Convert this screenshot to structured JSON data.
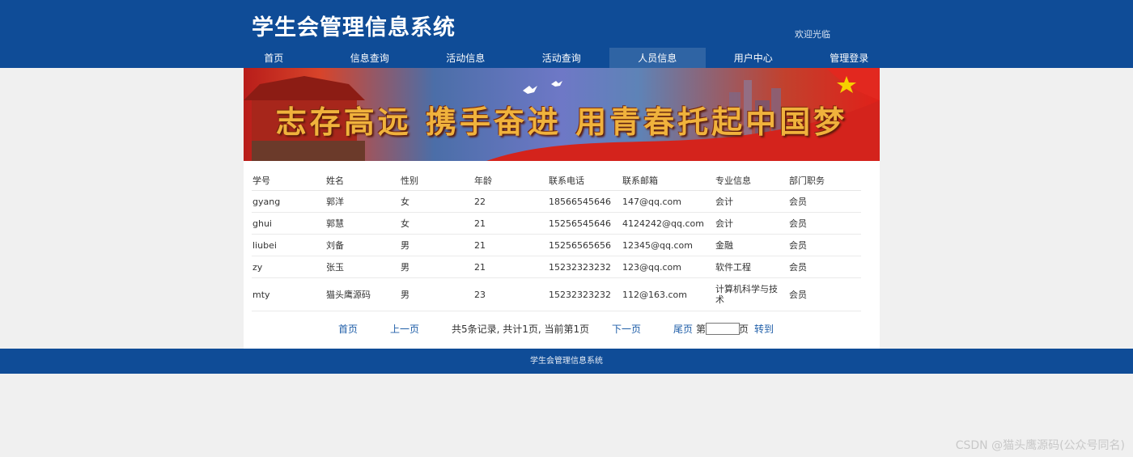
{
  "header": {
    "site_title": "学生会管理信息系统",
    "welcome": "欢迎光临"
  },
  "nav": {
    "items": [
      {
        "label": "首页",
        "active": false
      },
      {
        "label": "信息查询",
        "active": false
      },
      {
        "label": "活动信息",
        "active": false
      },
      {
        "label": "活动查询",
        "active": false
      },
      {
        "label": "人员信息",
        "active": true
      },
      {
        "label": "用户中心",
        "active": false
      },
      {
        "label": "管理登录",
        "active": false
      }
    ]
  },
  "banner": {
    "slogan": "志存高远 携手奋进 用青春托起中国梦"
  },
  "table": {
    "columns": [
      "学号",
      "姓名",
      "性别",
      "年龄",
      "联系电话",
      "联系邮箱",
      "专业信息",
      "部门职务"
    ],
    "rows": [
      [
        "gyang",
        "郭洋",
        "女",
        "22",
        "18566545646",
        "147@qq.com",
        "会计",
        "会员"
      ],
      [
        "ghui",
        "郭慧",
        "女",
        "21",
        "15256545646",
        "4124242@qq.com",
        "会计",
        "会员"
      ],
      [
        "liubei",
        "刘备",
        "男",
        "21",
        "15256565656",
        "12345@qq.com",
        "金融",
        "会员"
      ],
      [
        "zy",
        "张玉",
        "男",
        "21",
        "15232323232",
        "123@qq.com",
        "软件工程",
        "会员"
      ],
      [
        "mty",
        "猫头鹰源码",
        "男",
        "23",
        "15232323232",
        "112@163.com",
        "计算机科学与技术",
        "会员"
      ]
    ]
  },
  "pager": {
    "first": "首页",
    "prev": "上一页",
    "summary": "共5条记录, 共计1页, 当前第1页",
    "next": "下一页",
    "last": "尾页",
    "page_prefix": "第",
    "page_suffix": "页",
    "page_input": "",
    "go": "转到"
  },
  "footer": {
    "text": "学生会管理信息系统"
  },
  "watermark": "CSDN @猫头鹰源码(公众号同名)",
  "colors": {
    "header_bg": "#0f4c97",
    "nav_active": "#2f64a4",
    "page_bg": "#f0f0f0",
    "link": "#1f5ea8"
  }
}
